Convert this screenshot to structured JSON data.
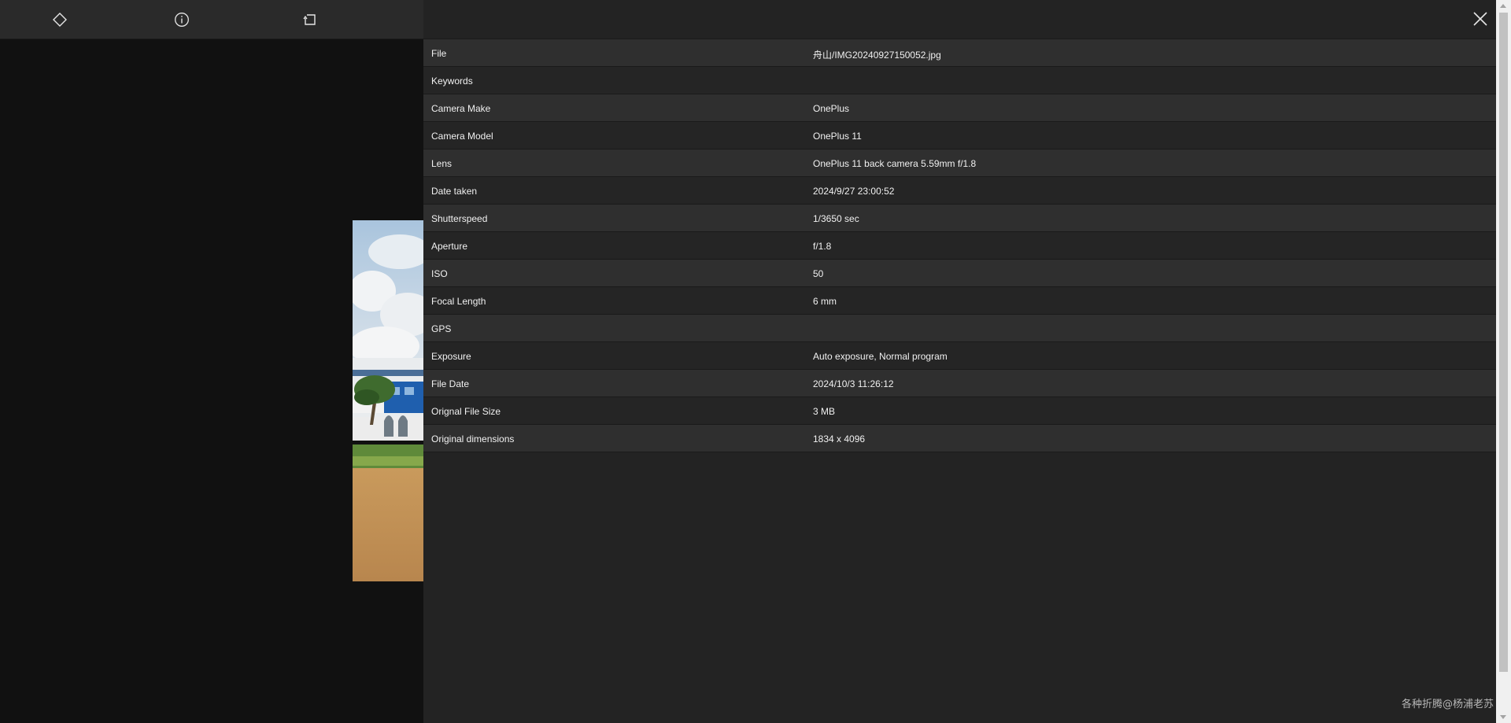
{
  "toolbar": {
    "icons": [
      "tag-icon",
      "info-icon",
      "rotate-icon"
    ]
  },
  "header": {
    "close_icon": "close-icon"
  },
  "details": [
    {
      "label": "File",
      "value": "舟山/IMG20240927150052.jpg"
    },
    {
      "label": "Keywords",
      "value": ""
    },
    {
      "label": "Camera Make",
      "value": "OnePlus"
    },
    {
      "label": "Camera Model",
      "value": "OnePlus 11"
    },
    {
      "label": "Lens",
      "value": "OnePlus 11 back camera 5.59mm f/1.8"
    },
    {
      "label": "Date taken",
      "value": "2024/9/27 23:00:52"
    },
    {
      "label": "Shutterspeed",
      "value": "1/3650 sec"
    },
    {
      "label": "Aperture",
      "value": "f/1.8"
    },
    {
      "label": "ISO",
      "value": "50"
    },
    {
      "label": "Focal Length",
      "value": "6 mm"
    },
    {
      "label": "GPS",
      "value": ""
    },
    {
      "label": "Exposure",
      "value": "Auto exposure, Normal program"
    },
    {
      "label": "File Date",
      "value": "2024/10/3 11:26:12"
    },
    {
      "label": "Orignal File Size",
      "value": "3 MB"
    },
    {
      "label": "Original dimensions",
      "value": "1834 x 4096"
    }
  ],
  "watermark": "各种折腾@杨浦老苏",
  "colors": {
    "toolbar_bg": "#2a2a2a",
    "viewer_bg": "#111111",
    "panel_bg": "#232323",
    "row_odd": "#2f2f2f",
    "row_even": "#252525",
    "text": "#f1f1f1"
  }
}
